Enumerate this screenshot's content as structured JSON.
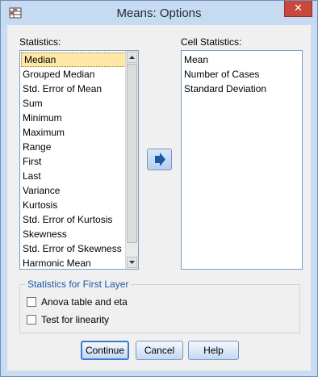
{
  "window": {
    "title": "Means: Options",
    "close_glyph": "✕"
  },
  "statistics": {
    "label": "Statistics:",
    "items": [
      "Median",
      "Grouped Median",
      "Std. Error of Mean",
      "Sum",
      "Minimum",
      "Maximum",
      "Range",
      "First",
      "Last",
      "Variance",
      "Kurtosis",
      "Std. Error of Kurtosis",
      "Skewness",
      "Std. Error of Skewness",
      "Harmonic Mean"
    ],
    "selected_index": 0
  },
  "cell_statistics": {
    "label": "Cell Statistics:",
    "items": [
      "Mean",
      "Number of Cases",
      "Standard Deviation"
    ]
  },
  "first_layer": {
    "title": "Statistics for First Layer",
    "anova_label": "Anova table and eta",
    "linearity_label": "Test for linearity",
    "anova_checked": false,
    "linearity_checked": false
  },
  "buttons": {
    "continue": "Continue",
    "cancel": "Cancel",
    "help": "Help"
  },
  "icons": {
    "app": "spss-table-icon",
    "move": "arrow-right-icon",
    "close": "close-icon"
  },
  "colors": {
    "accent": "#1d57a8",
    "selection": "#ffe8a6",
    "close": "#c9483c"
  }
}
